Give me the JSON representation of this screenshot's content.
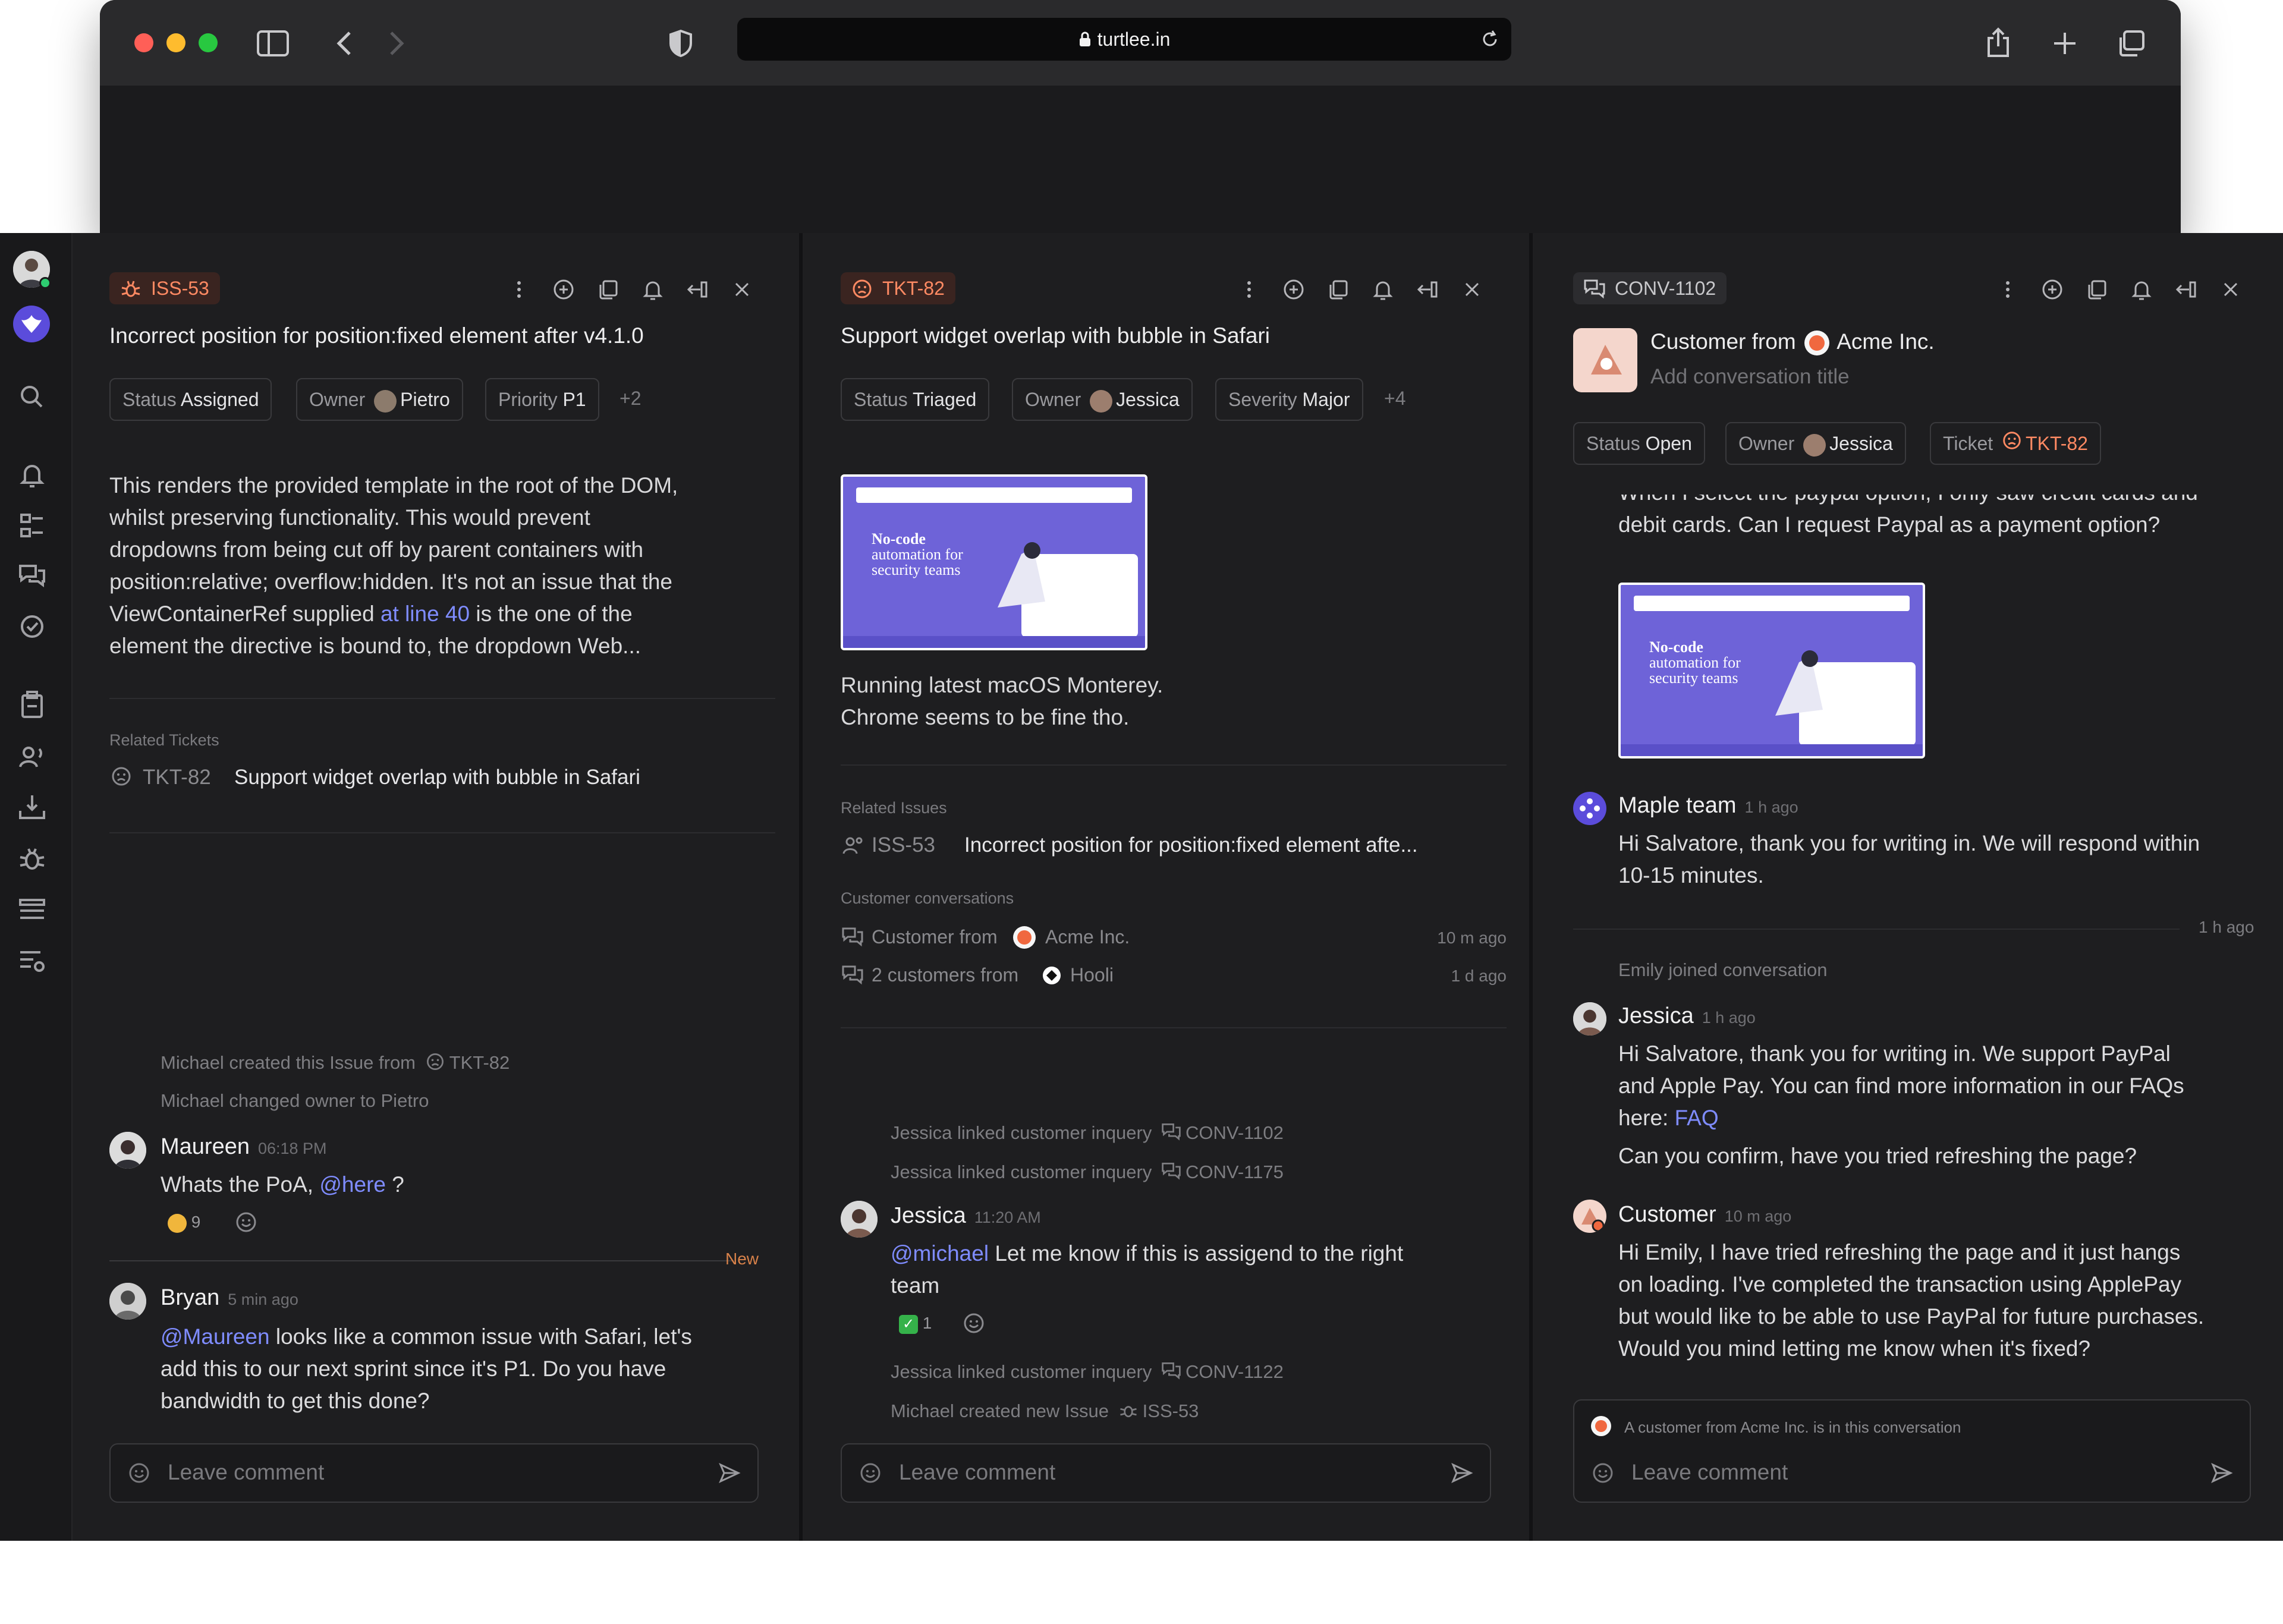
{
  "browser": {
    "url": "turtlee.in",
    "colors": {
      "close": "#ff5f57",
      "minimize": "#febc2e",
      "zoom": "#28c840"
    }
  },
  "rail": {
    "items": [
      "avatar",
      "workspace-icon",
      "search-icon",
      "bell-icon",
      "flow-icon",
      "chat-icon",
      "check-circle-icon",
      "clipboard-icon",
      "contacts-icon",
      "inbox-download-icon",
      "bug-icon",
      "layers-icon",
      "list-settings-icon"
    ]
  },
  "issue": {
    "id": "ISS-53",
    "title": "Incorrect position for position:fixed element after v4.1.0",
    "chips": {
      "status_label": "Status",
      "status_value": "Assigned",
      "owner_label": "Owner",
      "owner_value": "Pietro",
      "priority_label": "Priority",
      "priority_value": "P1",
      "more": "+2"
    },
    "description_lines": [
      "This renders the provided template in the root of the DOM,",
      "whilst preserving functionality. This would prevent",
      "dropdowns from being cut off by parent containers with",
      "position:relative; overflow:hidden. It's not an issue that the"
    ],
    "description_line5_pre": "ViewContainerRef supplied ",
    "description_line5_link": "at line 40",
    "description_line5_post": " is the one of the",
    "description_line6": "element the directive is bound to, the dropdown Web...",
    "related_title": "Related Tickets",
    "related": {
      "id": "TKT-82",
      "title": "Support widget overlap with bubble in Safari"
    },
    "activity": [
      {
        "pre": "Michael created this Issue from",
        "ref": "TKT-82"
      },
      {
        "pre": "Michael changed owner to Pietro",
        "ref": ""
      }
    ],
    "comments": [
      {
        "name": "Maureen",
        "time": "06:18 PM",
        "text_pre": "Whats the PoA, ",
        "mention": "@here",
        "text_post": " ?",
        "reaction_count": "9"
      },
      {
        "name": "Bryan",
        "time": "5 min ago",
        "mention": "@Maureen",
        "line1_post": " looks like a common issue with Safari, let's",
        "line2": "add this to our next sprint since it's P1. Do you have",
        "line3": "bandwidth to get this done?"
      }
    ],
    "new_label": "New",
    "comment_placeholder": "Leave comment"
  },
  "ticket": {
    "id": "TKT-82",
    "title": "Support widget overlap with bubble in Safari",
    "chips": {
      "status_label": "Status",
      "status_value": "Triaged",
      "owner_label": "Owner",
      "owner_value": "Jessica",
      "severity_label": "Severity",
      "severity_value": "Major",
      "more": "+4"
    },
    "screenshot_headline": [
      "No-code",
      "automation for",
      "security teams"
    ],
    "description_lines": [
      "Running latest macOS Monterey.",
      "Chrome seems to be fine tho."
    ],
    "related_issues_title": "Related Issues",
    "related_issue": {
      "id": "ISS-53",
      "title": "Incorrect position for position:fixed element afte..."
    },
    "conversations_title": "Customer conversations",
    "conversations": [
      {
        "pre": "Customer from",
        "org": "Acme Inc.",
        "time": "10 m ago"
      },
      {
        "pre": "2 customers from",
        "org": "Hooli",
        "time": "1 d ago"
      }
    ],
    "activity_top": [
      {
        "text": "Jessica linked customer inquery",
        "ref": "CONV-1102"
      },
      {
        "text": "Jessica linked customer inquery",
        "ref": "CONV-1175"
      }
    ],
    "comment": {
      "name": "Jessica",
      "time": "11:20 AM",
      "mention": "@michael",
      "line1_post": " Let me know if this is assigend to the right",
      "line2": "team",
      "reaction_count": "1"
    },
    "activity_bottom": [
      {
        "text": "Jessica linked customer inquery",
        "ref": "CONV-1122"
      },
      {
        "text": "Michael created new Issue",
        "ref": "ISS-53"
      }
    ],
    "comment_placeholder": "Leave comment"
  },
  "conversation": {
    "id": "CONV-1102",
    "title_pre": "Customer from",
    "title_org": "Acme Inc.",
    "title_placeholder": "Add conversation title",
    "chips": {
      "status_label": "Status",
      "status_value": "Open",
      "owner_label": "Owner",
      "owner_value": "Jessica",
      "ticket_label": "Ticket",
      "ticket_value": "TKT-82"
    },
    "first_msg_lines": [
      "When I select the paypal option, I only saw credit cards and",
      "debit cards. Can I request Paypal as a payment option?"
    ],
    "screenshot_headline": [
      "No-code",
      "automation for",
      "security teams"
    ],
    "maple": {
      "name": "Maple team",
      "time": "1 h ago",
      "line1": "Hi Salvatore, thank you for writing in. We will respond within",
      "line2": "10-15 minutes."
    },
    "divider_time": "1 h ago",
    "joined": "Emily joined conversation",
    "jessica": {
      "name": "Jessica",
      "time": "1 h ago",
      "line1": "Hi Salvatore, thank you for writing in. We support PayPal",
      "line2": "and Apple Pay. You can find more information in our FAQs",
      "line3_pre": "here: ",
      "line3_link": "FAQ",
      "line4": "Can you confirm, have you tried refreshing the page?"
    },
    "customer": {
      "name": "Customer",
      "time": "10 m ago",
      "line1": "Hi Emily, I have tried refreshing the page and it just hangs",
      "line2": "on loading. I've completed the transaction using ApplePay",
      "line3": "but would like to be able to use PayPal for future purchases.",
      "line4": "Would you mind letting me know when it's fixed?"
    },
    "notice": "A customer from Acme Inc. is in this conversation",
    "comment_placeholder": "Leave comment"
  },
  "colors": {
    "issue_accent": "#ff7a52",
    "link": "#7f8cff",
    "new": "#d9824a",
    "screenshot_bg": "#6e63d8"
  }
}
